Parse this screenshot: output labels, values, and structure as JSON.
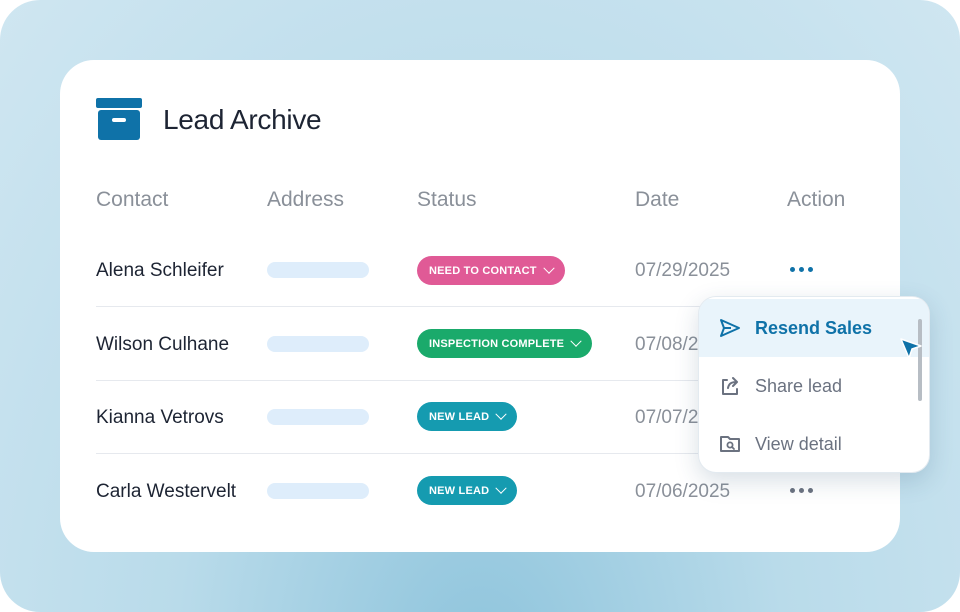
{
  "app": {
    "title": "Lead Archive",
    "icon": "archive-box-icon",
    "accent": "#0f72a8"
  },
  "table": {
    "headers": [
      "Contact",
      "Address",
      "Status",
      "Date",
      "Action"
    ],
    "rows": [
      {
        "contact": "Alena Schleifer",
        "status": "NEED TO CONTACT",
        "status_color": "#e05a96",
        "date": "07/29/2025",
        "action_color": "#0f72a8"
      },
      {
        "contact": "Wilson Culhane",
        "status": "INSPECTION COMPLETE",
        "status_color": "#1aaa6b",
        "date": "07/08/2025"
      },
      {
        "contact": "Kianna Vetrovs",
        "status": "NEW LEAD",
        "status_color": "#159bb0",
        "date": "07/07/2025"
      },
      {
        "contact": "Carla Westervelt",
        "status": "NEW LEAD",
        "status_color": "#159bb0",
        "date": "07/06/2025",
        "action_color": "#6b7280"
      }
    ]
  },
  "menu": {
    "items": [
      {
        "label": "Resend Sales",
        "icon": "send-icon"
      },
      {
        "label": "Share lead",
        "icon": "share-icon"
      },
      {
        "label": "View detail",
        "icon": "folder-search-icon"
      }
    ]
  }
}
